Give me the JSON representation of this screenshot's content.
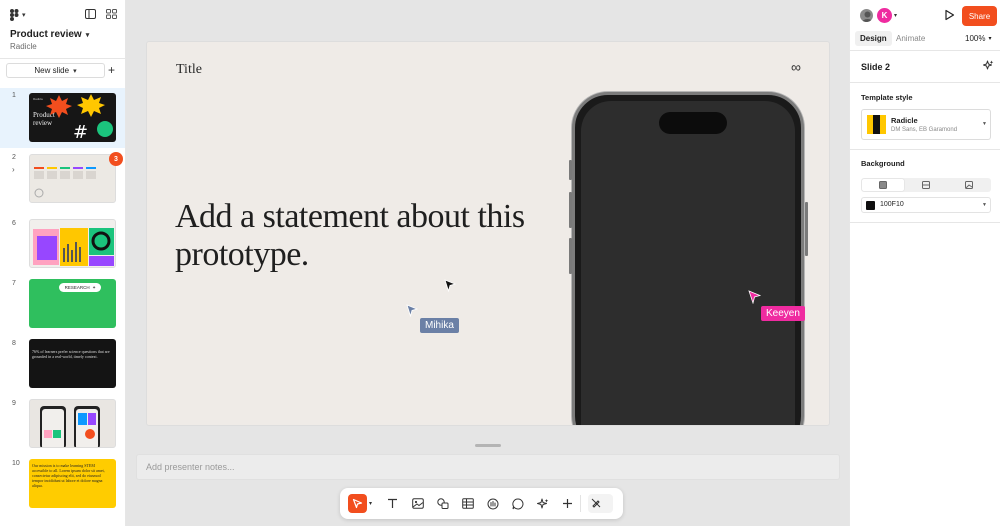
{
  "file": {
    "title": "Product review",
    "team": "Radicle"
  },
  "left_panel": {
    "new_slide_label": "New slide",
    "slides": [
      {
        "num": "1",
        "thumb_text": "Product review",
        "thumb_caption": "Radicle"
      },
      {
        "num": "2",
        "comment_count": "3"
      },
      {
        "num": "6"
      },
      {
        "num": "7",
        "pill_text": "RESEARCH"
      },
      {
        "num": "8",
        "thumb_text": "76% of learners prefer science questions that are grounded in a real-world, timely context."
      },
      {
        "num": "9"
      },
      {
        "num": "10",
        "thumb_text": "Our mission is to make learning STEM accessible to all. Lorem ipsum dolor sit amet, consectetur adipiscing elit, sed do eiusmod tempor incididunt ut labore et dolore magna aliqua."
      }
    ]
  },
  "slide": {
    "title": "Title",
    "logo_glyph": "∞",
    "statement": "Add a statement about this prototype."
  },
  "collaborators": [
    {
      "name": "Mihika",
      "color": "#6b80a6"
    },
    {
      "name": "Keeyen",
      "color": "#ef2ba0"
    }
  ],
  "notes": {
    "placeholder": "Add presenter notes..."
  },
  "toolbar": {
    "tools": [
      "move-tool",
      "text-tool",
      "image-tool",
      "shape-tool",
      "table-tool",
      "stamp-tool",
      "comment-tool",
      "ai-tool",
      "add-tool"
    ]
  },
  "right_panel": {
    "avatar_initial": "K",
    "share_label": "Share",
    "tabs": [
      "Design",
      "Animate"
    ],
    "zoom": "100%",
    "slide_name": "Slide 2",
    "template_style_label": "Template style",
    "template": {
      "name": "Radicle",
      "fonts": "DM Sans, EB Garamond"
    },
    "background_label": "Background",
    "background_hex": "100F10"
  },
  "colors": {
    "accent": "#f24e1e",
    "selected_bg": "#e8f3fd",
    "slide_bg": "#efebe7"
  }
}
